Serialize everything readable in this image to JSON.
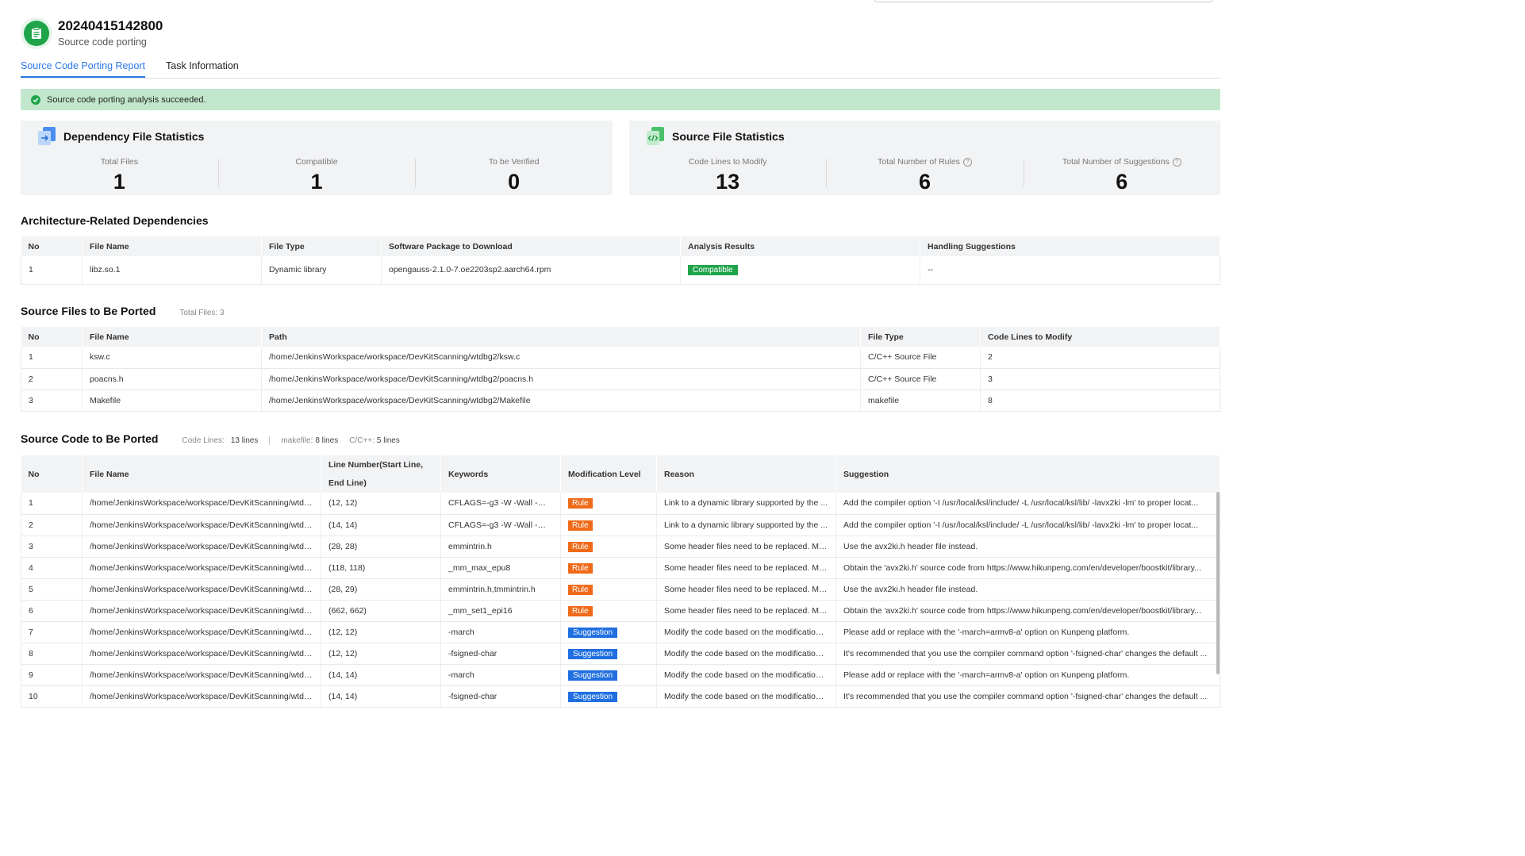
{
  "header": {
    "task_id": "20240415142800",
    "subtitle": "Source code porting",
    "icon": "clipboard-icon"
  },
  "tabs": [
    {
      "label": "Source Code Porting Report",
      "active": true
    },
    {
      "label": "Task Information",
      "active": false
    }
  ],
  "banner": {
    "text": "Source code porting analysis succeeded.",
    "status": "success"
  },
  "dependency_stats": {
    "title": "Dependency File Statistics",
    "items": [
      {
        "label": "Total Files",
        "value": "1"
      },
      {
        "label": "Compatible",
        "value": "1"
      },
      {
        "label": "To be Verified",
        "value": "0"
      }
    ]
  },
  "source_stats": {
    "title": "Source File Statistics",
    "items": [
      {
        "label": "Code Lines to Modify",
        "value": "13"
      },
      {
        "label": "Total Number of Rules",
        "value": "6"
      },
      {
        "label": "Total Number of Suggestions",
        "value": "6"
      }
    ]
  },
  "arch_deps": {
    "title": "Architecture-Related Dependencies",
    "columns": [
      "No",
      "File Name",
      "File Type",
      "Software Package to Download",
      "Analysis Results",
      "Handling Suggestions"
    ],
    "rows": [
      {
        "no": "1",
        "file_name": "libz.so.1",
        "file_type": "Dynamic library",
        "package": "opengauss-2.1.0-7.oe2203sp2.aarch64.rpm",
        "result": "Compatible",
        "suggestion": "--"
      }
    ]
  },
  "source_files": {
    "title": "Source Files to Be Ported",
    "total_label": "Total Files: 3",
    "columns": [
      "No",
      "File Name",
      "Path",
      "File Type",
      "Code Lines to Modify"
    ],
    "rows": [
      {
        "no": "1",
        "file_name": "ksw.c",
        "path": "/home/JenkinsWorkspace/workspace/DevKitScanning/wtdbg2/ksw.c",
        "file_type": "C/C++ Source File",
        "lines": "2"
      },
      {
        "no": "2",
        "file_name": "poacns.h",
        "path": "/home/JenkinsWorkspace/workspace/DevKitScanning/wtdbg2/poacns.h",
        "file_type": "C/C++ Source File",
        "lines": "3"
      },
      {
        "no": "3",
        "file_name": "Makefile",
        "path": "/home/JenkinsWorkspace/workspace/DevKitScanning/wtdbg2/Makefile",
        "file_type": "makefile",
        "lines": "8"
      }
    ]
  },
  "source_code": {
    "title": "Source Code to Be Ported",
    "code_lines_label": "Code Lines:",
    "code_lines_value": "13 lines",
    "makefile_label": "makefile:",
    "makefile_value": "8 lines",
    "cpp_label": "C/C++:",
    "cpp_value": "5 lines",
    "columns": [
      "No",
      "File Name",
      "Line Number(Start Line, End Line)",
      "Keywords",
      "Modification Level",
      "Reason",
      "Suggestion"
    ],
    "rows": [
      {
        "no": "1",
        "file": "/home/JenkinsWorkspace/workspace/DevKitScanning/wtdb...",
        "lines": "(12, 12)",
        "keywords": "CFLAGS=-g3 -W -Wall -Wn...",
        "level": "Rule",
        "reason": "Link to a dynamic library supported by the ...",
        "suggestion": "Add the compiler option '-I /usr/local/ksl/include/ -L /usr/local/ksl/lib/ -lavx2ki -lm' to proper locat..."
      },
      {
        "no": "2",
        "file": "/home/JenkinsWorkspace/workspace/DevKitScanning/wtdb...",
        "lines": "(14, 14)",
        "keywords": "CFLAGS=-g3 -W -Wall -Wn...",
        "level": "Rule",
        "reason": "Link to a dynamic library supported by the ...",
        "suggestion": "Add the compiler option '-I /usr/local/ksl/include/ -L /usr/local/ksl/lib/ -lavx2ki -lm' to proper locat..."
      },
      {
        "no": "3",
        "file": "/home/JenkinsWorkspace/workspace/DevKitScanning/wtdb...",
        "lines": "(28, 28)",
        "keywords": "emmintrin.h",
        "level": "Rule",
        "reason": "Some header files need to be replaced. Mo...",
        "suggestion": "Use the avx2ki.h header file instead."
      },
      {
        "no": "4",
        "file": "/home/JenkinsWorkspace/workspace/DevKitScanning/wtdb...",
        "lines": "(118, 118)",
        "keywords": "_mm_max_epu8",
        "level": "Rule",
        "reason": "Some header files need to be replaced. Mo...",
        "suggestion": "Obtain the 'avx2ki.h' source code from https://www.hikunpeng.com/en/developer/boostkit/library..."
      },
      {
        "no": "5",
        "file": "/home/JenkinsWorkspace/workspace/DevKitScanning/wtdb...",
        "lines": "(28, 29)",
        "keywords": "emmintrin.h,tmmintrin.h",
        "level": "Rule",
        "reason": "Some header files need to be replaced. Mo...",
        "suggestion": "Use the avx2ki.h header file instead."
      },
      {
        "no": "6",
        "file": "/home/JenkinsWorkspace/workspace/DevKitScanning/wtdb...",
        "lines": "(662, 662)",
        "keywords": "_mm_set1_epi16",
        "level": "Rule",
        "reason": "Some header files need to be replaced. Mo...",
        "suggestion": "Obtain the 'avx2ki.h' source code from https://www.hikunpeng.com/en/developer/boostkit/library..."
      },
      {
        "no": "7",
        "file": "/home/JenkinsWorkspace/workspace/DevKitScanning/wtdb...",
        "lines": "(12, 12)",
        "keywords": "-march",
        "level": "Suggestion",
        "reason": "Modify the code based on the modification ...",
        "suggestion": "Please add or replace with the '-march=armv8-a' option on Kunpeng platform."
      },
      {
        "no": "8",
        "file": "/home/JenkinsWorkspace/workspace/DevKitScanning/wtdb...",
        "lines": "(12, 12)",
        "keywords": "-fsigned-char",
        "level": "Suggestion",
        "reason": "Modify the code based on the modification ...",
        "suggestion": "It's recommended that you use the compiler command option '-fsigned-char' changes the default ..."
      },
      {
        "no": "9",
        "file": "/home/JenkinsWorkspace/workspace/DevKitScanning/wtdb...",
        "lines": "(14, 14)",
        "keywords": "-march",
        "level": "Suggestion",
        "reason": "Modify the code based on the modification ...",
        "suggestion": "Please add or replace with the '-march=armv8-a' option on Kunpeng platform."
      },
      {
        "no": "10",
        "file": "/home/JenkinsWorkspace/workspace/DevKitScanning/wtdb...",
        "lines": "(14, 14)",
        "keywords": "-fsigned-char",
        "level": "Suggestion",
        "reason": "Modify the code based on the modification ...",
        "suggestion": "It's recommended that you use the compiler command option '-fsigned-char' changes the default ..."
      }
    ]
  },
  "colors": {
    "accent": "#2a78e8",
    "success": "#1fa44a",
    "rule": "#ef6b1a",
    "suggestion": "#1f6fe0",
    "banner_bg": "#c2e7cc"
  }
}
